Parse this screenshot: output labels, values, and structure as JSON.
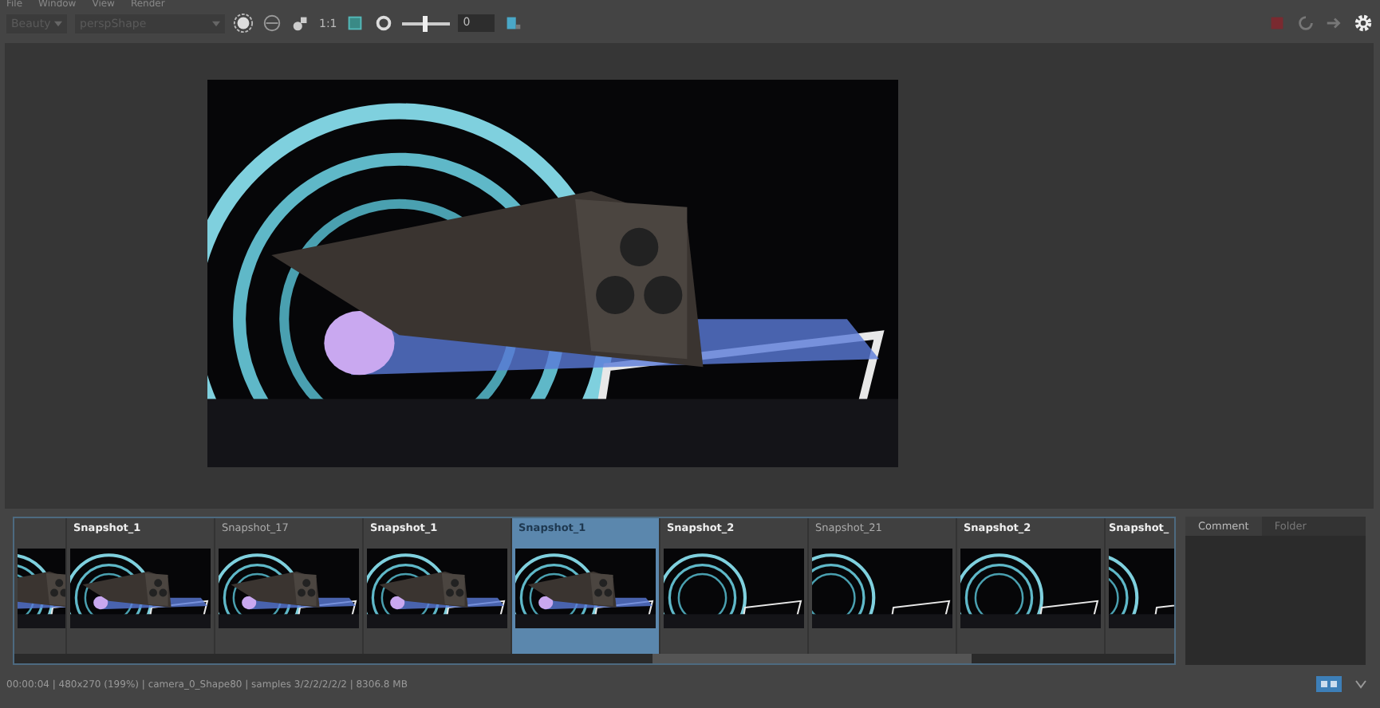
{
  "menu": [
    "File",
    "Window",
    "View",
    "Render"
  ],
  "toolbar": {
    "layer": "Beauty",
    "camera": "perspShape",
    "ratio": "1:1",
    "exposure": {
      "level": 0.45,
      "value": "0"
    }
  },
  "snapshots": [
    {
      "selected": false
    },
    {
      "label": "Snapshot_1",
      "selected": false,
      "bold": true
    },
    {
      "label": "Snapshot_17",
      "selected": false,
      "bold": false
    },
    {
      "label": "Snapshot_1",
      "selected": false,
      "bold": true
    },
    {
      "label": "Snapshot_1",
      "selected": true,
      "bold": true
    },
    {
      "label": "Snapshot_2",
      "selected": false,
      "bold": true
    },
    {
      "label": "Snapshot_21",
      "selected": false,
      "bold": false
    },
    {
      "label": "Snapshot_2",
      "selected": false,
      "bold": true
    },
    {
      "label": "Snapshot_",
      "selected": false,
      "bold": true
    }
  ],
  "side_tabs": [
    {
      "label": "Comment",
      "selected": true
    },
    {
      "label": "Folder",
      "selected": false
    }
  ],
  "status_bar": "00:00:04 | 480x270 (199%) | camera_0_Shape80 | samples 3/2/2/2/2/2 | 8306.8 MB"
}
